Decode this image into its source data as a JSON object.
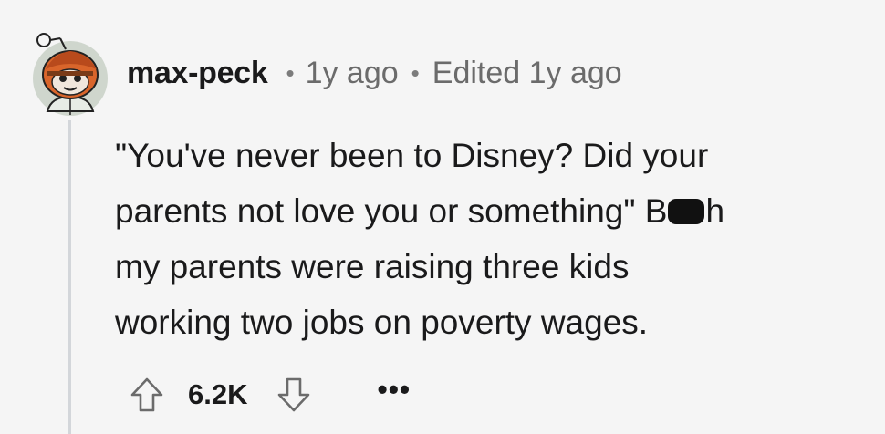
{
  "comment": {
    "username": "max-peck",
    "time": "1y ago",
    "edited": "Edited 1y ago",
    "body_lines": [
      "\"You've never been to Disney? Did your",
      "parents not love you or something\" B",
      "h",
      "my parents were raising three kids",
      "working two jobs on poverty wages."
    ],
    "score": "6.2K",
    "more_label": "•••"
  },
  "icons": {
    "avatar": "snoo-avatar-icon",
    "upvote": "arrow-up-icon",
    "downvote": "arrow-down-icon"
  },
  "colors": {
    "background": "#f5f5f5",
    "text": "#1a1a1b",
    "muted": "#6b6b6b",
    "thread_line": "#d3d6da"
  }
}
